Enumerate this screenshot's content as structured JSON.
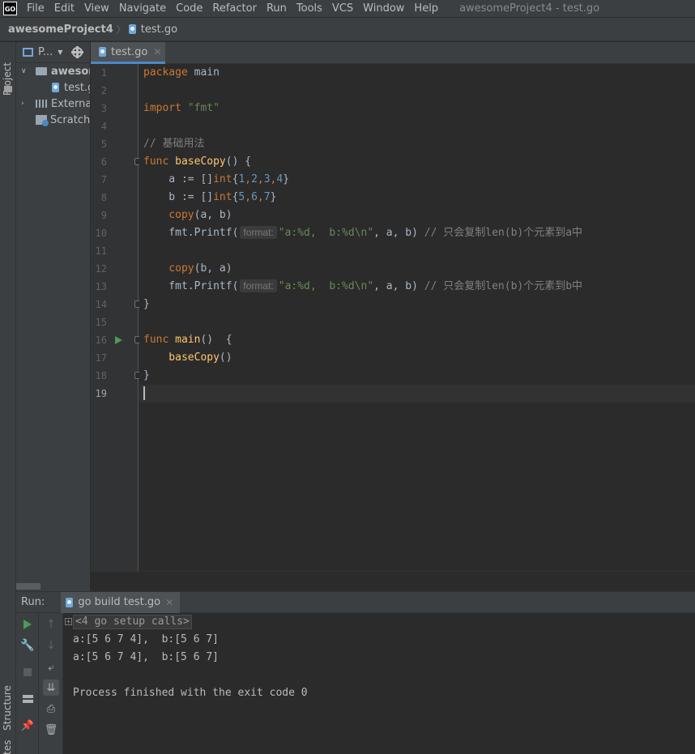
{
  "menubar": {
    "logo": "GO",
    "items": [
      "File",
      "Edit",
      "View",
      "Navigate",
      "Code",
      "Refactor",
      "Run",
      "Tools",
      "VCS",
      "Window",
      "Help"
    ],
    "window_title": "awesomeProject4 - test.go"
  },
  "breadcrumb": {
    "project": "awesomeProject4",
    "file": "test.go"
  },
  "left_strip": {
    "project": "Project",
    "structure": "Structure",
    "favorites": "tes"
  },
  "project_panel": {
    "title": "P...",
    "tree": [
      {
        "label": "awesom",
        "kind": "folder",
        "expanded": true
      },
      {
        "label": "test.g",
        "kind": "go-file"
      },
      {
        "label": "External",
        "kind": "library",
        "expanded": false
      },
      {
        "label": "Scratche",
        "kind": "scratch"
      }
    ]
  },
  "editor": {
    "tab": "test.go",
    "hint_label": "format:",
    "current_line": 19,
    "run_gutter_line": 16,
    "fold_lines": [
      6,
      14,
      16,
      18
    ],
    "lines": [
      {
        "no": "1"
      },
      {
        "no": "2"
      },
      {
        "no": "3"
      },
      {
        "no": "4"
      },
      {
        "no": "5"
      },
      {
        "no": "6"
      },
      {
        "no": "7"
      },
      {
        "no": "8"
      },
      {
        "no": "9"
      },
      {
        "no": "10"
      },
      {
        "no": "11"
      },
      {
        "no": "12"
      },
      {
        "no": "13"
      },
      {
        "no": "14"
      },
      {
        "no": "15"
      },
      {
        "no": "16"
      },
      {
        "no": "17"
      },
      {
        "no": "18"
      },
      {
        "no": "19"
      }
    ],
    "code": {
      "l1_kw": "package",
      "l1_name": " main",
      "l3_kw": "import",
      "l3_str": " \"fmt\"",
      "l5_cmt": "// 基础用法",
      "l6_kw": "func",
      "l6_fn": " baseCopy",
      "l6_rest": "() {",
      "l7_a": "    a := []",
      "l7_kw": "int",
      "l7_b": "{",
      "l7_n1": "1",
      "l7_c1": ",",
      "l7_n2": "2",
      "l7_c2": ",",
      "l7_n3": "3",
      "l7_c3": ",",
      "l7_n4": "4",
      "l7_e": "}",
      "l8_a": "    b := []",
      "l8_kw": "int",
      "l8_b": "{",
      "l8_n1": "5",
      "l8_c1": ",",
      "l8_n2": "6",
      "l8_c2": ",",
      "l8_n3": "7",
      "l8_e": "}",
      "l9_fn": "    copy",
      "l9_rest": "(a, b)",
      "l10_a": "    fmt.Printf(",
      "l10_str": "\"a:%d,  b:%d\\n\"",
      "l10_rest": ", a, b) ",
      "l10_cmt": "// 只会复制len(b)个元素到a中",
      "l12_fn": "    copy",
      "l12_rest": "(b, a)",
      "l13_a": "    fmt.Printf(",
      "l13_str": "\"a:%d,  b:%d\\n\"",
      "l13_rest": ", a, b) ",
      "l13_cmt": "// 只会复制len(b)个元素到b中",
      "l14": "}",
      "l16_kw": "func",
      "l16_fn": " main",
      "l16_rest": "()  {",
      "l17_fn": "    baseCopy",
      "l17_rest": "()",
      "l18": "}"
    }
  },
  "run_panel": {
    "label": "Run:",
    "tab": "go build test.go",
    "output": {
      "setup_calls": "<4 go setup calls>",
      "line1": "a:[5 6 7 4],  b:[5 6 7]",
      "line2": "a:[5 6 7 4],  b:[5 6 7]",
      "finished": "Process finished with the exit code 0"
    }
  },
  "colors": {
    "keyword": "#cc7832",
    "string": "#6a8759",
    "number": "#6897bb",
    "function": "#ffc66d",
    "comment": "#808080",
    "run_green": "#499c54",
    "accent_blue": "#4a88c7"
  }
}
